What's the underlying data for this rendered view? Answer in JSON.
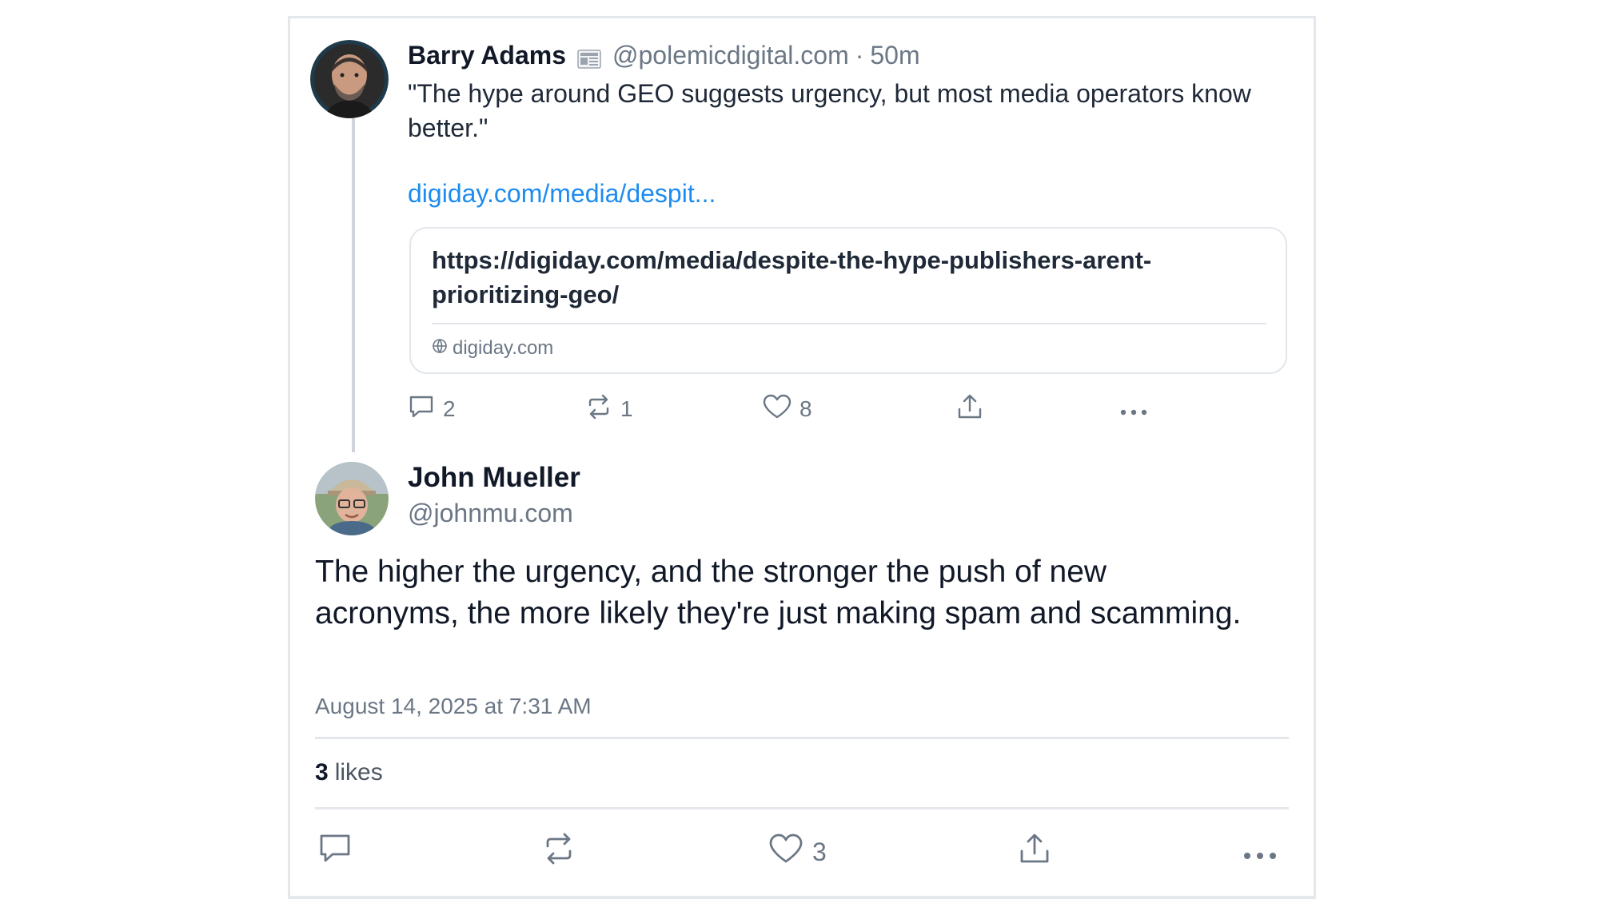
{
  "parent_post": {
    "author_name": "Barry Adams",
    "author_handle": "@polemicdigital.com",
    "separator": "·",
    "time_ago": "50m",
    "text": "\"The hype around GEO suggests urgency, but most media operators know better.\"",
    "link_text": "digiday.com/media/despit...",
    "embed": {
      "title": "https://digiday.com/media/despite-the-hype-publishers-arent-prioritizing-geo/",
      "domain": "digiday.com"
    },
    "actions": {
      "reply_count": "2",
      "repost_count": "1",
      "like_count": "8"
    }
  },
  "main_post": {
    "author_name": "John Mueller",
    "author_handle": "@johnmu.com",
    "text": "The higher the urgency, and the stronger the push of new acronyms, the more likely they're just making spam and scamming.",
    "timestamp": "August 14, 2025 at 7:31 AM",
    "likes_count": "3",
    "likes_label": "likes",
    "actions": {
      "like_count": "3"
    }
  },
  "icons": {
    "reply": "reply-icon",
    "repost": "repost-icon",
    "like": "heart-icon",
    "share": "share-icon",
    "more": "more-icon",
    "globe": "globe-icon",
    "badge": "newspaper-badge-icon"
  },
  "colors": {
    "link": "#1d8cf0",
    "muted": "#6b7785",
    "border": "#e4e7eb"
  }
}
